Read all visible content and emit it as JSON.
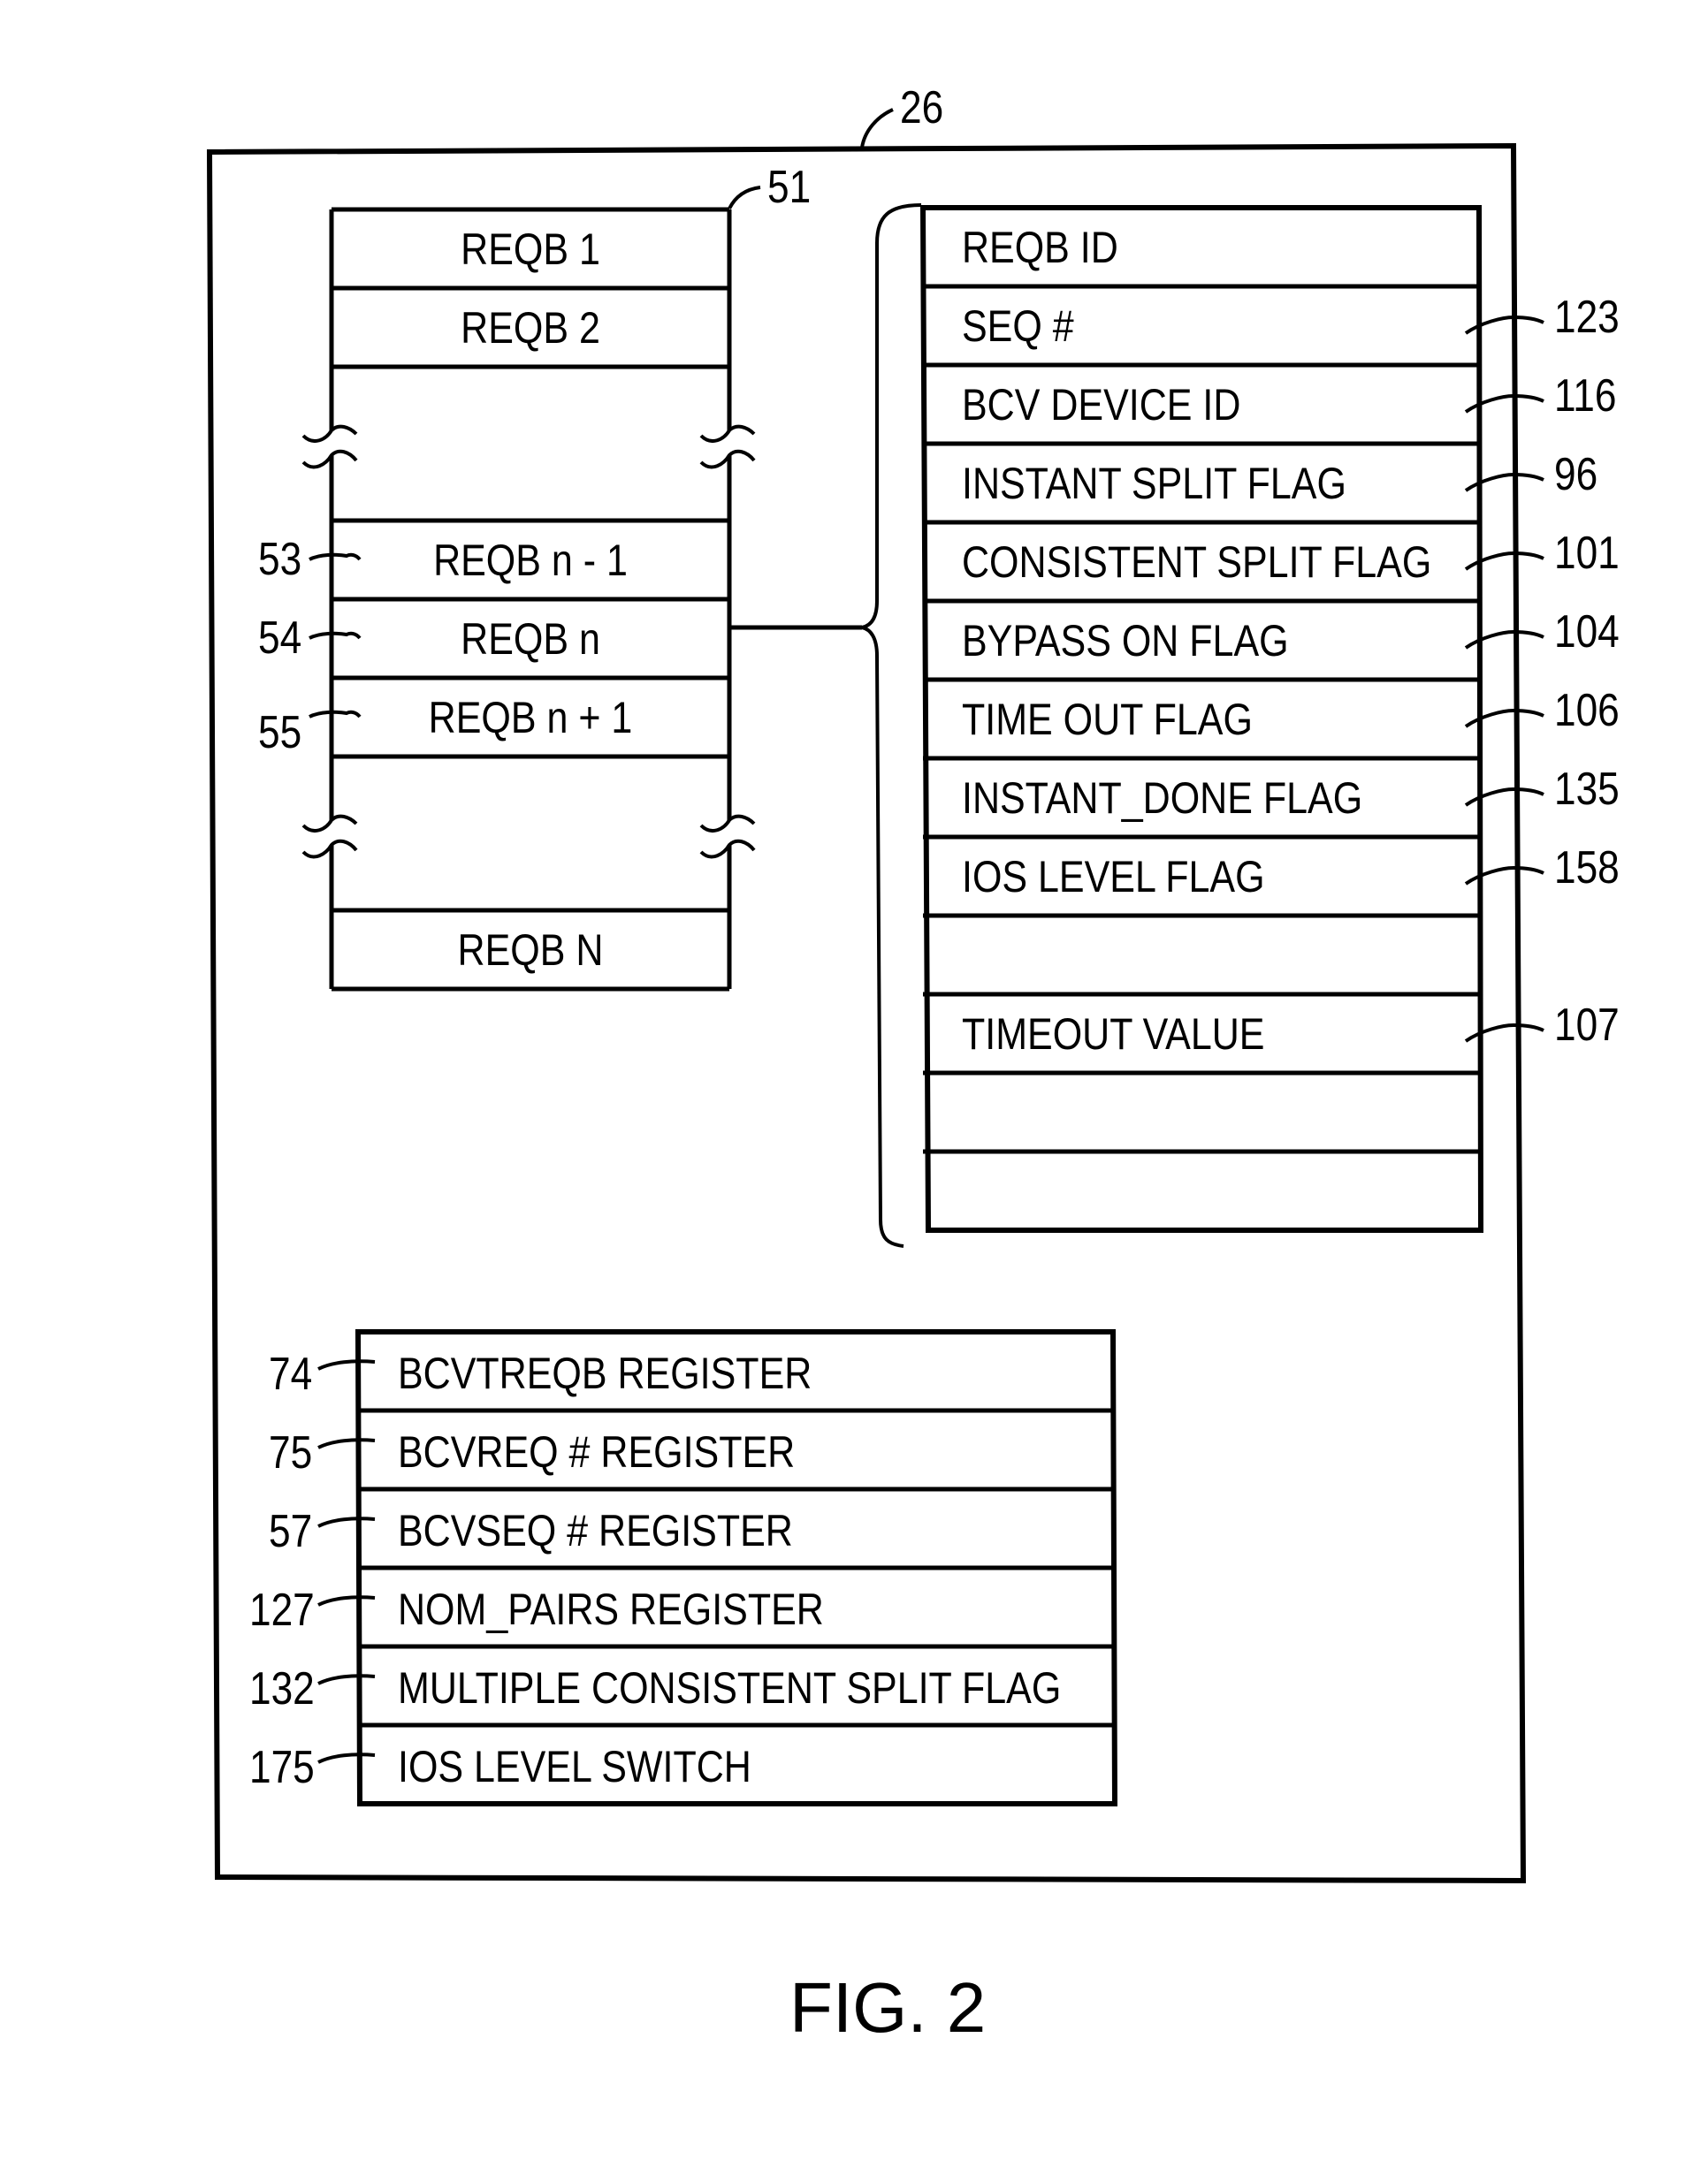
{
  "figure": {
    "caption": "FIG. 2",
    "memory_ref": "26"
  },
  "request_queue": {
    "ref": "51",
    "rows": [
      {
        "label": "REQB 1",
        "ref": ""
      },
      {
        "label": "REQB 2",
        "ref": ""
      },
      {
        "label": "",
        "ref": "",
        "break": true
      },
      {
        "label": "REQB n - 1",
        "ref": "53"
      },
      {
        "label": "REQB n",
        "ref": "54"
      },
      {
        "label": "REQB n + 1",
        "ref": "55"
      },
      {
        "label": "",
        "ref": "",
        "break": true
      },
      {
        "label": "REQB N",
        "ref": ""
      }
    ]
  },
  "reqb_detail": {
    "expands": "REQB n",
    "fields": [
      {
        "label": "REQB ID",
        "ref": ""
      },
      {
        "label": "SEQ #",
        "ref": "123"
      },
      {
        "label": "BCV DEVICE ID",
        "ref": "116"
      },
      {
        "label": "INSTANT SPLIT FLAG",
        "ref": "96"
      },
      {
        "label": "CONSISTENT SPLIT FLAG",
        "ref": "101"
      },
      {
        "label": "BYPASS ON FLAG",
        "ref": "104"
      },
      {
        "label": "TIME OUT FLAG",
        "ref": "106"
      },
      {
        "label": "INSTANT_DONE FLAG",
        "ref": "135"
      },
      {
        "label": "IOS LEVEL FLAG",
        "ref": "158"
      },
      {
        "label": "",
        "ref": ""
      },
      {
        "label": "TIMEOUT VALUE",
        "ref": "107"
      },
      {
        "label": "",
        "ref": ""
      },
      {
        "label": "",
        "ref": ""
      }
    ]
  },
  "registers": {
    "rows": [
      {
        "label": "BCVTREQB REGISTER",
        "ref": "74"
      },
      {
        "label": "BCVREQ # REGISTER",
        "ref": "75"
      },
      {
        "label": "BCVSEQ # REGISTER",
        "ref": "57"
      },
      {
        "label": "NOM_PAIRS REGISTER",
        "ref": "127"
      },
      {
        "label": "MULTIPLE CONSISTENT SPLIT FLAG",
        "ref": "132"
      },
      {
        "label": "IOS LEVEL SWITCH",
        "ref": "175"
      }
    ]
  }
}
